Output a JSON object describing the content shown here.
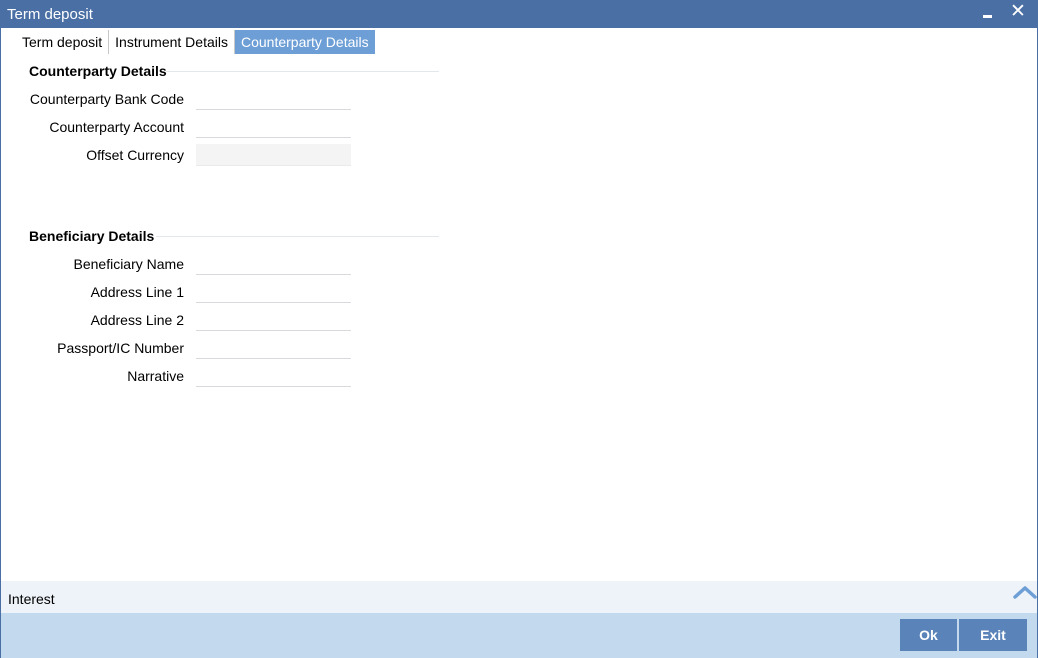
{
  "window": {
    "title": "Term deposit"
  },
  "tabs": [
    {
      "label": "Term deposit",
      "active": false
    },
    {
      "label": "Instrument Details",
      "active": false
    },
    {
      "label": "Counterparty Details",
      "active": true
    }
  ],
  "counterparty": {
    "section_title": "Counterparty Details",
    "fields": [
      {
        "label": "Counterparty Bank Code",
        "value": ""
      },
      {
        "label": "Counterparty Account",
        "value": ""
      },
      {
        "label": "Offset Currency",
        "value": ""
      }
    ]
  },
  "beneficiary": {
    "section_title": "Beneficiary Details",
    "fields": [
      {
        "label": "Beneficiary Name",
        "value": ""
      },
      {
        "label": "Address Line 1",
        "value": ""
      },
      {
        "label": "Address Line 2",
        "value": ""
      },
      {
        "label": "Passport/IC Number",
        "value": ""
      },
      {
        "label": "Narrative",
        "value": ""
      }
    ]
  },
  "interest_bar": {
    "label": "Interest",
    "icon": "chevron-up-icon"
  },
  "footer": {
    "ok_label": "Ok",
    "exit_label": "Exit"
  },
  "colors": {
    "titlebar": "#4a6fa5",
    "active_tab": "#6d9fd6",
    "footer": "#c3d9ee",
    "button": "#5a84b9"
  }
}
